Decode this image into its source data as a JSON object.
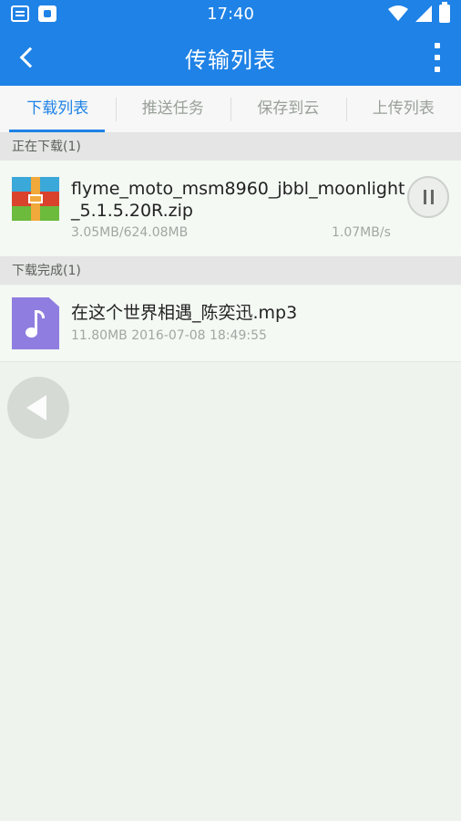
{
  "status_bar": {
    "time": "17:40",
    "left_icons": [
      "notification-doc-icon",
      "notification-app-icon"
    ],
    "right_icons": [
      "wifi-icon",
      "signal-icon",
      "battery-icon"
    ]
  },
  "header": {
    "title": "传输列表",
    "back_icon": "back-arrow-icon",
    "menu_icon": "more-vertical-icon",
    "background_color": "#1f82e6"
  },
  "tabs": [
    {
      "label": "下载列表",
      "active": true
    },
    {
      "label": "推送任务",
      "active": false
    },
    {
      "label": "保存到云",
      "active": false
    },
    {
      "label": "上传列表",
      "active": false
    }
  ],
  "sections": {
    "downloading": {
      "header": "正在下载(1)",
      "items": [
        {
          "name_line1": "flyme_moto_msm8960_jbbl_moonlight",
          "name_line2": "_5.1.5.20R.zip",
          "progress": "3.05MB/624.08MB",
          "speed": "1.07MB/s",
          "icon": "zip-archive-icon",
          "action_icon": "pause-icon"
        }
      ]
    },
    "completed": {
      "header": "下载完成(1)",
      "items": [
        {
          "name": "在这个世界相遇_陈奕迅.mp3",
          "meta": "11.80MB 2016-07-08 18:49:55",
          "icon": "music-file-icon"
        }
      ]
    }
  },
  "floating_button": {
    "icon": "floating-back-icon"
  },
  "colors": {
    "accent": "#1f82e6",
    "background": "#eef3ee"
  }
}
